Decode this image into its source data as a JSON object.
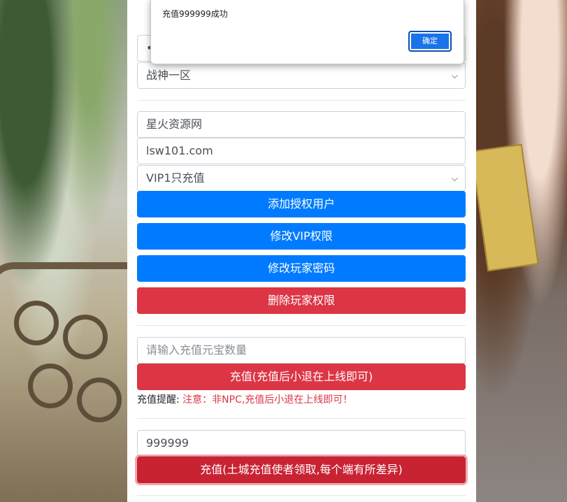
{
  "dialog": {
    "message": "充值999999成功",
    "ok_label": "确定"
  },
  "top_password_field": {
    "value": "•"
  },
  "server_select": {
    "selected": "战神一区"
  },
  "auth_section": {
    "user_field": {
      "value": "星火资源网"
    },
    "password_field": {
      "value": "lsw101.com"
    },
    "vip_select": {
      "selected": "VIP1只充值"
    },
    "add_user_label": "添加授权用户",
    "modify_vip_label": "修改VIP权限",
    "modify_password_label": "修改玩家密码",
    "delete_rights_label": "删除玩家权限"
  },
  "recharge_section": {
    "amount_field": {
      "placeholder": "请输入充值元宝数量"
    },
    "recharge_label": "充值(充值后小退在上线即可)",
    "hint_label": "充值提醒:",
    "hint_warning": "注意：非NPC,充值后小退在上线即可！"
  },
  "mail_section": {
    "amount_field": {
      "value": "999999"
    },
    "recharge_label": "充值(土城充值使者领取,每个端有所差异)"
  },
  "colors": {
    "primary": "#007bff",
    "danger": "#dc3545",
    "dialog_button": "#1a73e8"
  },
  "icons": {
    "select_arrow": "chevron-down-icon"
  }
}
